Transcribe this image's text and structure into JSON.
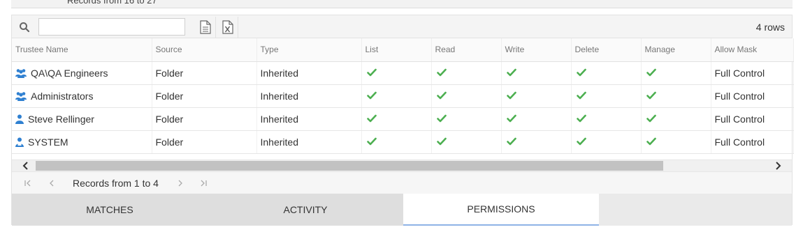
{
  "top_pager": {
    "text": "Records from 16 to 27"
  },
  "toolbar": {
    "search_placeholder": "",
    "row_count": "4 rows"
  },
  "table": {
    "columns": [
      "Trustee Name",
      "Source",
      "Type",
      "List",
      "Read",
      "Write",
      "Delete",
      "Manage",
      "Allow Mask"
    ],
    "rows": [
      {
        "trustee": "QA\\QA Engineers",
        "icon": "group-icon",
        "source": "Folder",
        "type": "Inherited",
        "list": true,
        "read": true,
        "write": true,
        "delete": true,
        "manage": true,
        "allow_mask": "Full Control"
      },
      {
        "trustee": "Administrators",
        "icon": "group-icon",
        "source": "Folder",
        "type": "Inherited",
        "list": true,
        "read": true,
        "write": true,
        "delete": true,
        "manage": true,
        "allow_mask": "Full Control"
      },
      {
        "trustee": "Steve Rellinger",
        "icon": "user-icon",
        "source": "Folder",
        "type": "Inherited",
        "list": true,
        "read": true,
        "write": true,
        "delete": true,
        "manage": true,
        "allow_mask": "Full Control"
      },
      {
        "trustee": "SYSTEM",
        "icon": "system-user-icon",
        "source": "Folder",
        "type": "Inherited",
        "list": true,
        "read": true,
        "write": true,
        "delete": true,
        "manage": true,
        "allow_mask": "Full Control"
      }
    ]
  },
  "pager": {
    "text": "Records from 1 to 4"
  },
  "tabs": [
    {
      "label": "MATCHES",
      "active": false
    },
    {
      "label": "ACTIVITY",
      "active": false
    },
    {
      "label": "PERMISSIONS",
      "active": true
    }
  ],
  "colors": {
    "check": "#4caf50",
    "icon_blue": "#2f80d1",
    "active_tab_border": "#8eb3e6"
  }
}
